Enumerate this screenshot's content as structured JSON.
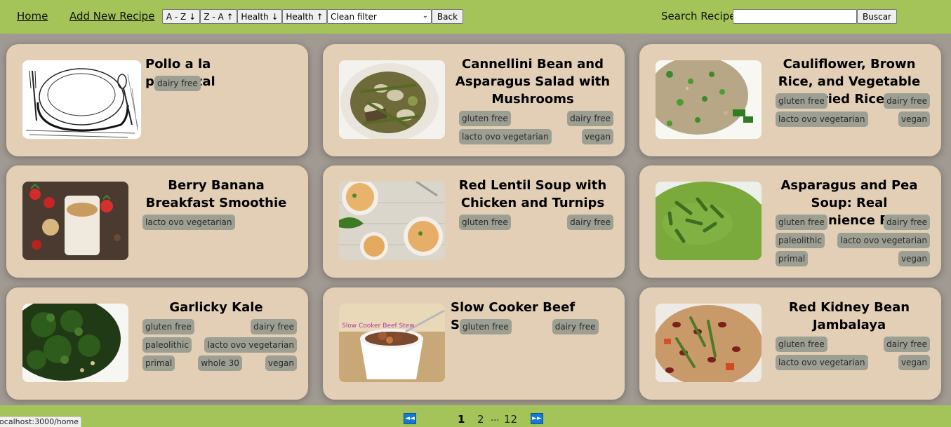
{
  "nav": {
    "home": "Home",
    "add_recipe": "Add New Recipe",
    "sort_az": "A - Z ↓",
    "sort_za": "Z - A ↑",
    "health_desc": "Health ↓",
    "health_asc": "Health ↑",
    "filter_selected": "Clean filter",
    "back": "Back",
    "search_label": "Search Recipe:",
    "search_value": "",
    "search_button": "Buscar"
  },
  "recipes": [
    {
      "title": "Pollo a la provenzal",
      "tags": [
        "dairy free"
      ],
      "image": "plate-sketch"
    },
    {
      "title": "Cannellini Bean and Asparagus Salad with Mushrooms",
      "tags": [
        "gluten free",
        "dairy free",
        "lacto ovo vegetarian",
        "vegan"
      ],
      "image": "bean-salad"
    },
    {
      "title": "Cauliflower, Brown Rice, and Vegetable Fried Rice",
      "tags": [
        "gluten free",
        "dairy free",
        "lacto ovo vegetarian",
        "vegan"
      ],
      "image": "fried-rice"
    },
    {
      "title": "Berry Banana Breakfast Smoothie",
      "tags": [
        "lacto ovo vegetarian"
      ],
      "image": "smoothie"
    },
    {
      "title": "Red Lentil Soup with Chicken and Turnips",
      "tags": [
        "gluten free",
        "dairy free"
      ],
      "image": "lentil-soup"
    },
    {
      "title": "Asparagus and Pea Soup: Real Convenience Food",
      "tags": [
        "gluten free",
        "dairy free",
        "paleolithic",
        "lacto ovo vegetarian",
        "primal",
        "vegan"
      ],
      "image": "pea-soup"
    },
    {
      "title": "Garlicky Kale",
      "tags": [
        "gluten free",
        "dairy free",
        "paleolithic",
        "lacto ovo vegetarian",
        "primal",
        "whole 30",
        "vegan"
      ],
      "image": "kale"
    },
    {
      "title": "Slow Cooker Beef Stew",
      "tags": [
        "gluten free",
        "dairy free"
      ],
      "image": "beef-stew"
    },
    {
      "title": "Red Kidney Bean Jambalaya",
      "tags": [
        "gluten free",
        "dairy free",
        "lacto ovo vegetarian",
        "vegan"
      ],
      "image": "jambalaya"
    }
  ],
  "photo_caption": "Slow Cooker Beef Stew",
  "pagination": {
    "first": "◄◄",
    "pages": [
      "1",
      "2",
      "...",
      "12"
    ],
    "last": "►►",
    "current": "1"
  },
  "status_url": "localhost:3000/home",
  "colors": {
    "navbar": "#a4c45a",
    "background": "#a09a92",
    "card": "#e2cfb6",
    "tag": "#9c9f92",
    "pager_button": "#1479d6"
  }
}
